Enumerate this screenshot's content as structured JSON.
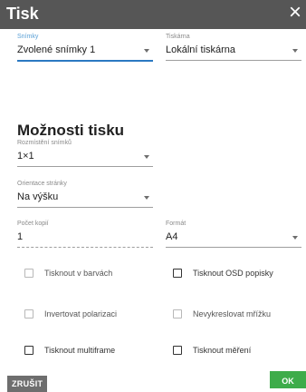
{
  "dialog": {
    "title": "Tisk"
  },
  "snimky": {
    "label": "Snímky",
    "value": "Zvolené snímky 1"
  },
  "tiskarna": {
    "label": "Tiskárna",
    "value": "Lokální tiskárna"
  },
  "options": {
    "title": "Možnosti tisku"
  },
  "layout": {
    "label": "Rozmístění snímků",
    "value": "1×1"
  },
  "orientation": {
    "label": "Orientace stránky",
    "value": "Na výšku"
  },
  "copies": {
    "label": "Počet kopií",
    "value": "1"
  },
  "format": {
    "label": "Formát",
    "value": "A4"
  },
  "checkboxes": [
    {
      "label": "Tisknout v barvách",
      "checked": false,
      "enabled": false
    },
    {
      "label": "Tisknout OSD popisky",
      "checked": false,
      "enabled": true
    },
    {
      "label": "Invertovat polarizaci",
      "checked": false,
      "enabled": false
    },
    {
      "label": "Nevykreslovat mřížku",
      "checked": false,
      "enabled": false
    },
    {
      "label": "Tisknout multiframe",
      "checked": false,
      "enabled": true
    },
    {
      "label": "Tisknout měření",
      "checked": false,
      "enabled": true
    }
  ],
  "buttons": {
    "cancel": "ZRUŠIT",
    "ok": "OK"
  },
  "colors": {
    "titlebar": "#565656",
    "accent": "#2b79c2",
    "ok": "#3eac4a",
    "cancel": "#6e6e6e"
  }
}
